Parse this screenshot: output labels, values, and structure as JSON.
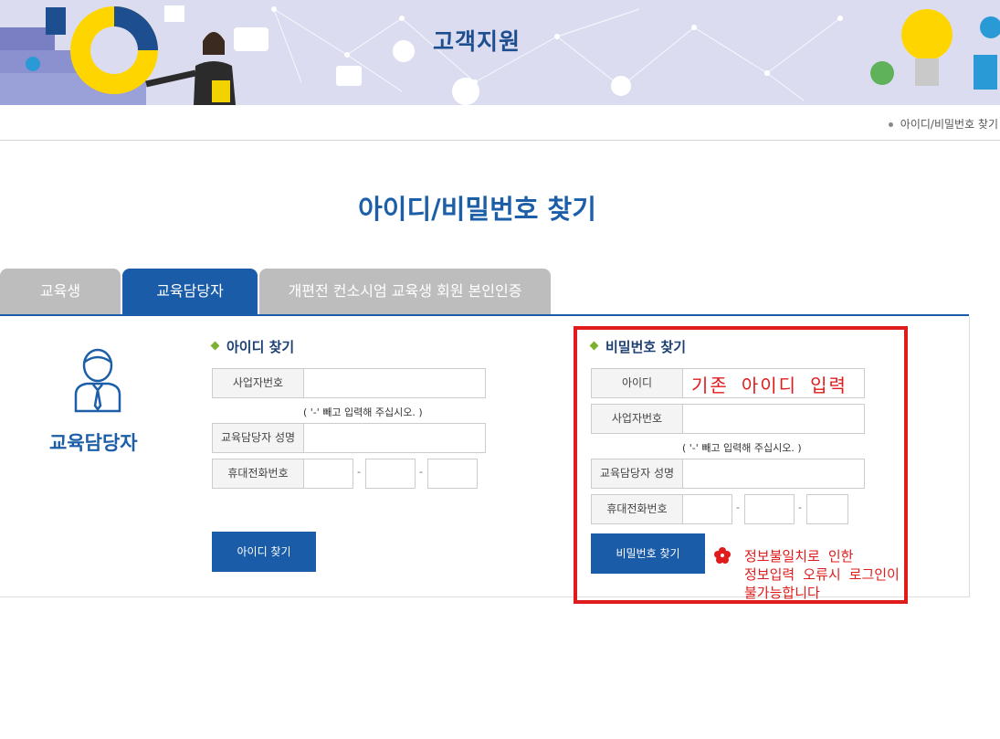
{
  "header": {
    "title": "고객지원"
  },
  "breadcrumb": {
    "current": "아이디/비밀번호 찾기"
  },
  "page_title": "아이디/비밀번호 찾기",
  "tabs": [
    {
      "label": "교육생",
      "active": false
    },
    {
      "label": "교육담당자",
      "active": true
    },
    {
      "label": "개편전 컨소시엄 교육생 회원 본인인증",
      "active": false
    }
  ],
  "side": {
    "label": "교육담당자"
  },
  "find_id": {
    "title": "아이디 찾기",
    "business_no_label": "사업자번호",
    "business_no_hint": "( '-' 빼고 입력해 주십시오. )",
    "name_label": "교육담당자 성명",
    "phone_label": "휴대전화번호",
    "dash": "-",
    "button": "아이디 찾기"
  },
  "find_pw": {
    "title": "비밀번호 찾기",
    "id_label": "아이디",
    "business_no_label": "사업자번호",
    "business_no_hint": "( '-' 빼고 입력해 주십시오. )",
    "name_label": "교육담당자 성명",
    "phone_label": "휴대전화번호",
    "dash": "-",
    "button": "비밀번호 찾기"
  },
  "annotations": {
    "id_input_note": "기존 아이디 입력",
    "warning_line1": "정보불일치로 인한",
    "warning_line2": "정보입력 오류시 로그인이",
    "warning_line3": "불가능합니다",
    "color": "#e01b1b"
  },
  "colors": {
    "primary": "#1a5ca8",
    "tab_inactive": "#bdbdbd",
    "accent_green": "#7cb030"
  }
}
